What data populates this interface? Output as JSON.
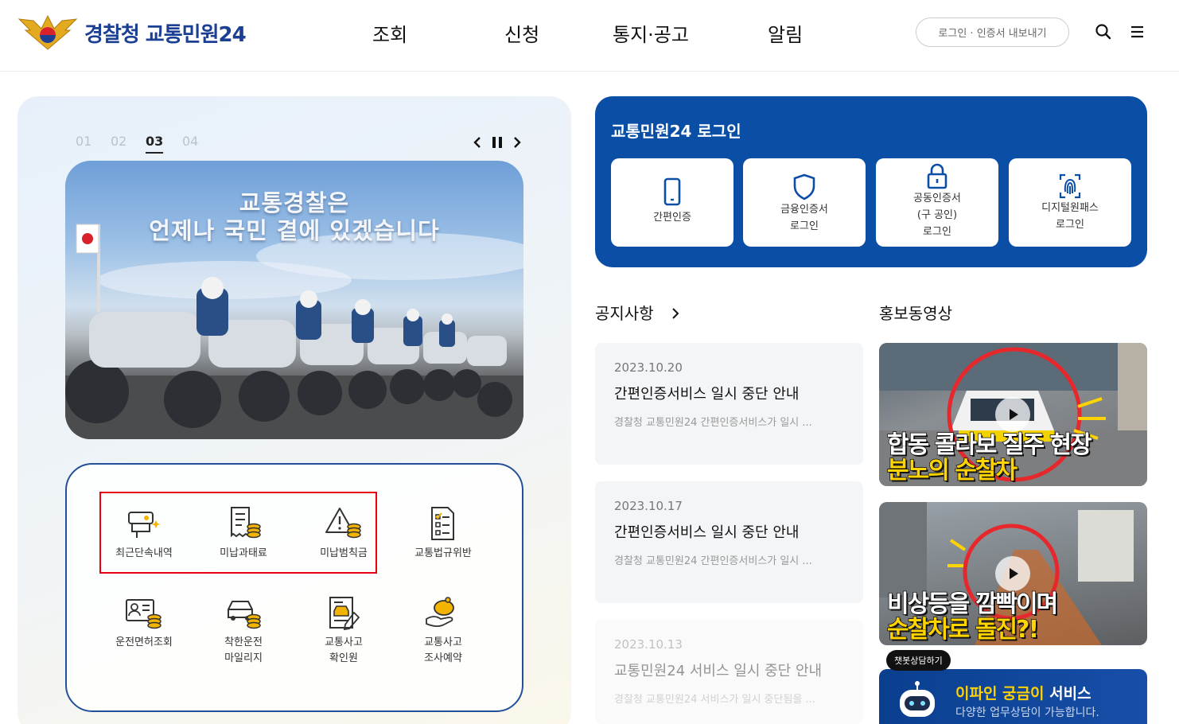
{
  "header": {
    "logo_text": "경찰청 교통민원24",
    "nav": [
      "조회",
      "신청",
      "통지·공고",
      "알림"
    ],
    "login_export": "로그인 · 인증서 내보내기",
    "icons": [
      "search-icon",
      "menu-icon"
    ]
  },
  "slider": {
    "numbers": [
      "01",
      "02",
      "03",
      "04"
    ],
    "active": "03",
    "banner_title_line1": "교통경찰은",
    "banner_title_line2": "언제나 국민 곁에 있겠습니다"
  },
  "quick_menu": [
    {
      "label": "최근단속내역",
      "icon": "camera-icon"
    },
    {
      "label": "미납과태료",
      "icon": "receipt-coins-icon"
    },
    {
      "label": "미납범칙금",
      "icon": "warning-coins-icon"
    },
    {
      "label": "교통법규위반",
      "icon": "checklist-icon"
    },
    {
      "label": "운전면허조회",
      "icon": "id-card-icon"
    },
    {
      "label": "착한운전\n마일리지",
      "line1": "착한운전",
      "line2": "마일리지",
      "icon": "car-coins-icon"
    },
    {
      "label": "교통사고\n확인원",
      "line1": "교통사고",
      "line2": "확인원",
      "icon": "accident-doc-icon"
    },
    {
      "label": "교통사고\n조사예약",
      "line1": "교통사고",
      "line2": "조사예약",
      "icon": "piggy-hand-icon"
    }
  ],
  "login": {
    "title": "교통민원24 로그인",
    "buttons": [
      {
        "line1": "간편인증",
        "line2": "",
        "line3": "",
        "icon": "smartphone-icon"
      },
      {
        "line1": "금융인증서",
        "line2": "로그인",
        "line3": "",
        "icon": "shield-icon"
      },
      {
        "line1": "공동인증서",
        "line2": "(구 공인)",
        "line3": "로그인",
        "icon": "lock-icon"
      },
      {
        "line1": "디지털원패스",
        "line2": "로그인",
        "line3": "",
        "icon": "fingerprint-icon"
      }
    ]
  },
  "notices": {
    "title": "공지사항",
    "items": [
      {
        "date": "2023.10.20",
        "title": "간편인증서비스 일시 중단 안내",
        "desc": "경찰청 교통민원24 간편인증서비스가 일시 ..."
      },
      {
        "date": "2023.10.17",
        "title": "간편인증서비스 일시 중단 안내",
        "desc": "경찰청 교통민원24 간편인증서비스가 일시 ..."
      },
      {
        "date": "2023.10.13",
        "title": "교통민원24 서비스 일시 중단 안내",
        "desc": "경찰청 교통민원24 서비스가 일시 중단됨을 ..."
      }
    ]
  },
  "videos": {
    "title": "홍보동영상",
    "items": [
      {
        "cap_line1": "합동 콜라보 질주 현장",
        "cap_line2": "분노의 순찰차"
      },
      {
        "cap_line1": "비상등을 깜빡이며",
        "cap_line2": "순찰차로 돌진?!"
      }
    ]
  },
  "chatbot": {
    "badge": "챗봇상담하기",
    "title_hl": "이파인 궁금이",
    "title_rest": " 서비스",
    "subtitle": "다양한 업무상담이 가능합니다."
  },
  "colors": {
    "brand_blue": "#0a4ea6",
    "logo_text": "#1b3f93",
    "highlight_red": "#e60012",
    "chat_highlight": "#ffd200"
  }
}
